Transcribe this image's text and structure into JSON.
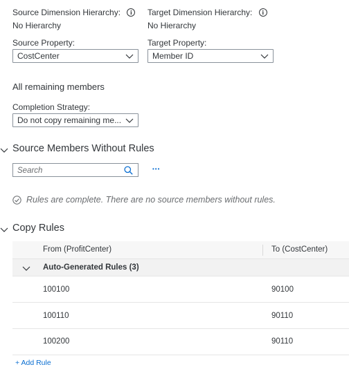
{
  "source_dimension_hierarchy": {
    "label": "Source Dimension Hierarchy:",
    "value": "No Hierarchy"
  },
  "target_dimension_hierarchy": {
    "label": "Target Dimension Hierarchy:",
    "value": "No Hierarchy"
  },
  "source_property": {
    "label": "Source Property:",
    "value": "CostCenter"
  },
  "target_property": {
    "label": "Target Property:",
    "value": "Member ID"
  },
  "remaining": {
    "heading": "All remaining members",
    "completion_label": "Completion Strategy:",
    "completion_value": "Do not copy remaining me..."
  },
  "source_members_section": {
    "title": "Source Members Without Rules",
    "search_placeholder": "Search",
    "more_label": "•••",
    "status_message": "Rules are complete. There are no source members without rules."
  },
  "copy_rules_section": {
    "title": "Copy Rules",
    "columns": [
      "From (ProfitCenter)",
      "To (CostCenter)"
    ],
    "group": {
      "label": "Auto-Generated Rules (3)"
    },
    "rows": [
      {
        "from": "100100",
        "to": "90100"
      },
      {
        "from": "100110",
        "to": "90110"
      },
      {
        "from": "100200",
        "to": "90110"
      }
    ],
    "add_rule_label": "Add Rule"
  },
  "colors": {
    "link": "#0a6ed1",
    "border": "#89919a",
    "text": "#32363a",
    "muted": "#6a6d70"
  }
}
